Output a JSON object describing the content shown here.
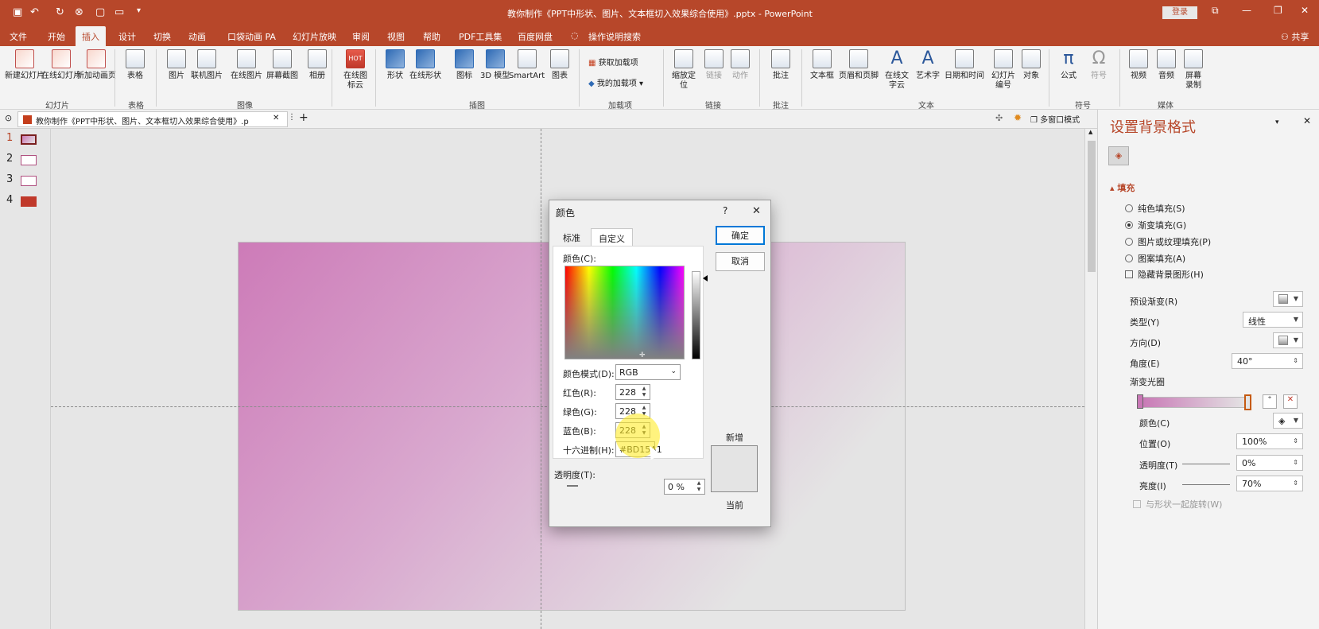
{
  "window": {
    "title": "教你制作《PPT中形状、图片、文本框切入效果综合使用》.pptx  -  PowerPoint",
    "login": "登录",
    "share": "共享"
  },
  "menu": [
    "文件",
    "开始",
    "插入",
    "设计",
    "切换",
    "动画",
    "口袋动画 PA",
    "幻灯片放映",
    "审阅",
    "视图",
    "帮助",
    "PDF工具集",
    "百度网盘",
    "操作说明搜索"
  ],
  "ribbon": {
    "slides": {
      "new_slide": "新建幻灯片",
      "online_slide": "在线幻灯片",
      "new_anim_page": "新加动画页",
      "group": "幻灯片"
    },
    "tables": {
      "table": "表格",
      "group": "表格"
    },
    "images": {
      "picture": "图片",
      "online_picture": "联机图片",
      "online_picture2": "在线图片",
      "screenshot": "屏幕截图",
      "album": "相册",
      "group": "图像"
    },
    "online": {
      "icon_cloud": "在线图标云",
      "hot": "HOT"
    },
    "illustrations": {
      "shapes": "形状",
      "online_shapes": "在线形状",
      "icons": "图标",
      "model3d": "3D 模型",
      "smartart": "SmartArt",
      "chart": "图表",
      "group": "插图"
    },
    "addins": {
      "get": "获取加载项",
      "mine": "我的加载项",
      "group": "加载项"
    },
    "links": {
      "zoom": "缩放定位",
      "link": "链接",
      "action": "动作",
      "group": "链接"
    },
    "comments": {
      "comment": "批注",
      "group": "批注"
    },
    "text": {
      "textbox": "文本框",
      "header_footer": "页眉和页脚",
      "online_text": "在线文字云",
      "wordart": "艺术字",
      "datetime": "日期和时间",
      "slide_num": "幻灯片编号",
      "object": "对象",
      "group": "文本"
    },
    "symbols": {
      "equation": "公式",
      "symbol": "符号",
      "group": "符号"
    },
    "media": {
      "video": "视频",
      "audio": "音频",
      "screen_record": "屏幕录制",
      "group": "媒体"
    }
  },
  "doc_tab": "教你制作《PPT中形状、图片、文本框切入效果综合使用》.p",
  "multi_window": "多窗口模式",
  "slides": [
    "1",
    "2",
    "3",
    "4"
  ],
  "pane": {
    "title": "设置背景格式",
    "fill_header": "填充",
    "solid": "纯色填充(S)",
    "gradient": "渐变填充(G)",
    "picture": "图片或纹理填充(P)",
    "pattern": "图案填充(A)",
    "hide_bg": "隐藏背景图形(H)",
    "preset": "预设渐变(R)",
    "type_label": "类型(Y)",
    "type_value": "线性",
    "direction": "方向(D)",
    "angle_label": "角度(E)",
    "angle_value": "40°",
    "stops": "渐变光圈",
    "color": "颜色(C)",
    "position_label": "位置(O)",
    "position_value": "100%",
    "transparency_label": "透明度(T)",
    "transparency_value": "0%",
    "brightness_label": "亮度(I)",
    "brightness_value": "70%",
    "rotate_with_shape": "与形状一起旋转(W)"
  },
  "dialog": {
    "title": "颜色",
    "help": "?",
    "close": "✕",
    "tab_standard": "标准",
    "tab_custom": "自定义",
    "colors_label": "颜色(C):",
    "model_label": "颜色模式(D):",
    "model_value": "RGB",
    "red_label": "红色(R):",
    "red_value": "228",
    "green_label": "绿色(G):",
    "green_value": "228",
    "blue_label": "蓝色(B):",
    "blue_value": "228",
    "hex_label": "十六进制(H):",
    "hex_value": "#BD15A1",
    "transparency_label": "透明度(T):",
    "transparency_value": "0 %",
    "ok": "确定",
    "cancel": "取消",
    "new": "新增",
    "current": "当前"
  }
}
